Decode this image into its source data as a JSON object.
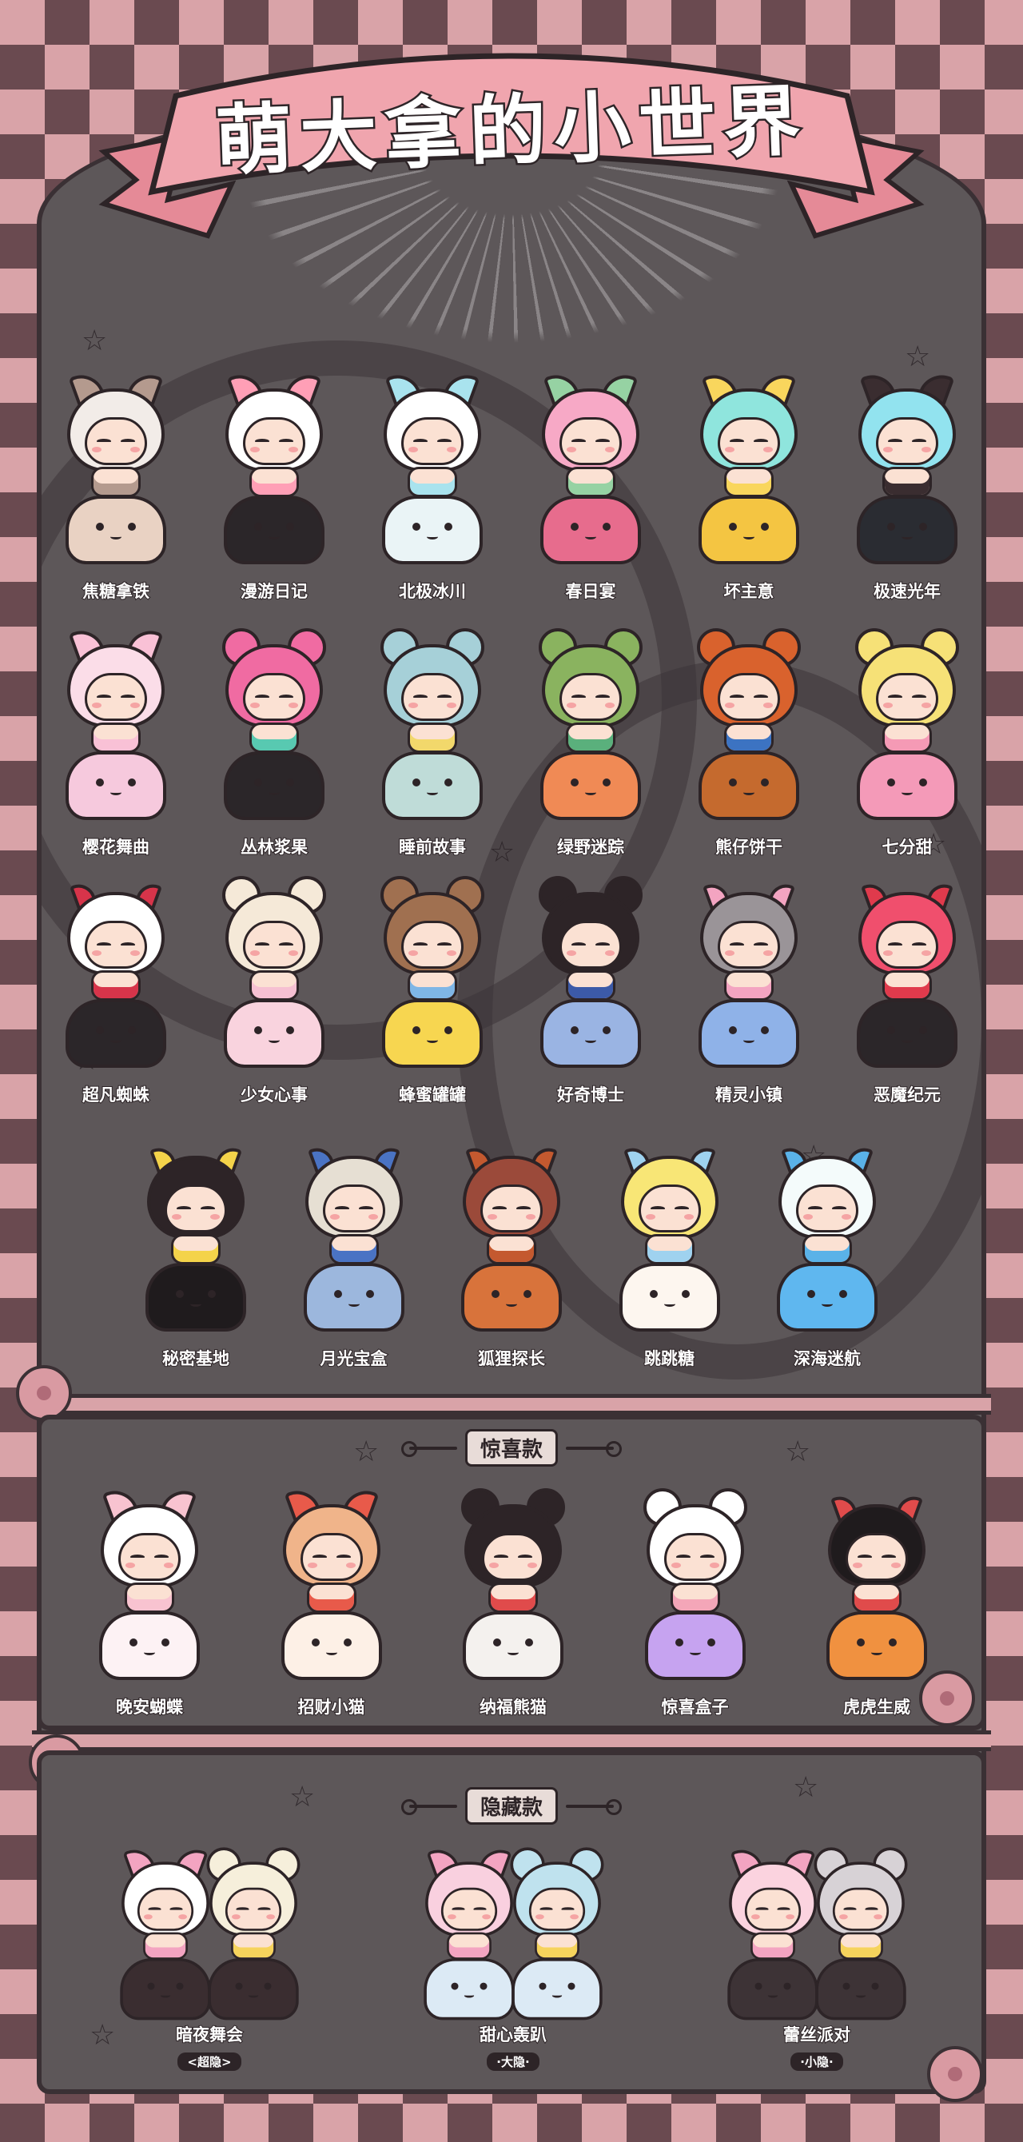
{
  "title": "萌大拿的小世界",
  "colors": {
    "background_pink": "#d9a3a8",
    "background_dark": "#6a4a50",
    "panel": "#5d5759",
    "banner": "#f0a5ae",
    "outline": "#2d2427"
  },
  "regular": [
    {
      "label": "焦糖拿铁",
      "hair": "#f2ece8",
      "accent": "#b49a8e",
      "base": "#e9d2c3",
      "top": "ears"
    },
    {
      "label": "漫游日记",
      "hair": "#ffffff",
      "accent": "#ff9fb6",
      "base": "#2b2629",
      "top": "ears"
    },
    {
      "label": "北极冰川",
      "hair": "#ffffff",
      "accent": "#a9e3ee",
      "base": "#eaf4f6",
      "top": "ears"
    },
    {
      "label": "春日宴",
      "hair": "#f7a9c6",
      "accent": "#96d2a3",
      "base": "#e76c8d",
      "top": "ears"
    },
    {
      "label": "坏主意",
      "hair": "#8fe5dd",
      "accent": "#f9d65d",
      "base": "#f4c542",
      "top": "ears"
    },
    {
      "label": "极速光年",
      "hair": "#92e3ef",
      "accent": "#3a2d30",
      "base": "#2a2c32",
      "top": "ears"
    },
    {
      "label": "樱花舞曲",
      "hair": "#fbdde8",
      "accent": "#f9c1d6",
      "base": "#f6c9dd",
      "top": "ears"
    },
    {
      "label": "丛林浆果",
      "hair": "#f06ba2",
      "accent": "#58c9b1",
      "base": "#2b2629",
      "top": "buns"
    },
    {
      "label": "睡前故事",
      "hair": "#a6d0d8",
      "accent": "#f2d86b",
      "base": "#bfdcd8",
      "top": "buns"
    },
    {
      "label": "绿野迷踪",
      "hair": "#8ab35f",
      "accent": "#5ab07c",
      "base": "#f08a55",
      "top": "buns"
    },
    {
      "label": "熊仔饼干",
      "hair": "#d9622d",
      "accent": "#3c73c2",
      "base": "#c56a2e",
      "top": "buns"
    },
    {
      "label": "七分甜",
      "hair": "#f6e177",
      "accent": "#f59ab5",
      "base": "#f49ab8",
      "top": "buns"
    },
    {
      "label": "超凡蜘蛛",
      "hair": "#ffffff",
      "accent": "#d7344a",
      "base": "#2b2629",
      "top": "horns"
    },
    {
      "label": "少女心事",
      "hair": "#f5e9d8",
      "accent": "#f6c0d2",
      "base": "#f9d3de",
      "top": "buns"
    },
    {
      "label": "蜂蜜罐罐",
      "hair": "#a07050",
      "accent": "#7fb6e6",
      "base": "#f7d650",
      "top": "buns"
    },
    {
      "label": "好奇博士",
      "hair": "#2d2427",
      "accent": "#3c5aa8",
      "base": "#9ab4e3",
      "top": "buns"
    },
    {
      "label": "精灵小镇",
      "hair": "#9a9498",
      "accent": "#f3a4c1",
      "base": "#8fb2e8",
      "top": "horns"
    },
    {
      "label": "恶魔纪元",
      "hair": "#f04f6d",
      "accent": "#e03a4c",
      "base": "#2b2629",
      "top": "horns"
    }
  ],
  "regular_row4": [
    {
      "label": "秘密基地",
      "hair": "#2d2427",
      "accent": "#f4d34a",
      "base": "#1f1b1d",
      "top": "horns"
    },
    {
      "label": "月光宝盒",
      "hair": "#e6dfd3",
      "accent": "#4a73c4",
      "base": "#9cb7dd",
      "top": "horns"
    },
    {
      "label": "狐狸探长",
      "hair": "#9b4a3a",
      "accent": "#c4592f",
      "base": "#d8733b",
      "top": "horns"
    },
    {
      "label": "跳跳糖",
      "hair": "#f8e676",
      "accent": "#9fd2ef",
      "base": "#fdf6ef",
      "top": "horns"
    },
    {
      "label": "深海迷航",
      "hair": "#f4fbfb",
      "accent": "#5ab2e8",
      "base": "#5fb7ef",
      "top": "horns"
    }
  ],
  "surprise": {
    "title": "惊喜款",
    "items": [
      {
        "label": "晚安蝴蝶",
        "hair": "#ffffff",
        "accent": "#f8c3d0",
        "base": "#fdf2f4",
        "top": "ears"
      },
      {
        "label": "招财小猫",
        "hair": "#f0b48a",
        "accent": "#e85a4a",
        "base": "#fdf0e6",
        "top": "ears"
      },
      {
        "label": "纳福熊猫",
        "hair": "#2d2427",
        "accent": "#e04b4b",
        "base": "#f4f1ee",
        "top": "buns"
      },
      {
        "label": "惊喜盒子",
        "hair": "#ffffff",
        "accent": "#f4a6b8",
        "base": "#c6a3f0",
        "top": "buns"
      },
      {
        "label": "虎虎生威",
        "hair": "#1f1b1d",
        "accent": "#e04b4b",
        "base": "#f09140",
        "top": "horns"
      }
    ]
  },
  "hidden": {
    "title": "隐藏款",
    "items": [
      {
        "label": "暗夜舞会",
        "tag": "<超隐>",
        "left_hair": "#ffffff",
        "right_hair": "#f6efdb",
        "left_top": "ears",
        "right_top": "buns",
        "base": "#3a2d30"
      },
      {
        "label": "甜心轰趴",
        "tag": "·大隐·",
        "left_hair": "#f9d0df",
        "right_hair": "#bfe2ee",
        "left_top": "ears",
        "right_top": "buns",
        "base": "#dceaf5"
      },
      {
        "label": "蕾丝派对",
        "tag": "·小隐·",
        "left_hair": "#fbd3df",
        "right_hair": "#d7d2d6",
        "left_top": "ears",
        "right_top": "buns",
        "base": "#3d3336"
      }
    ]
  }
}
